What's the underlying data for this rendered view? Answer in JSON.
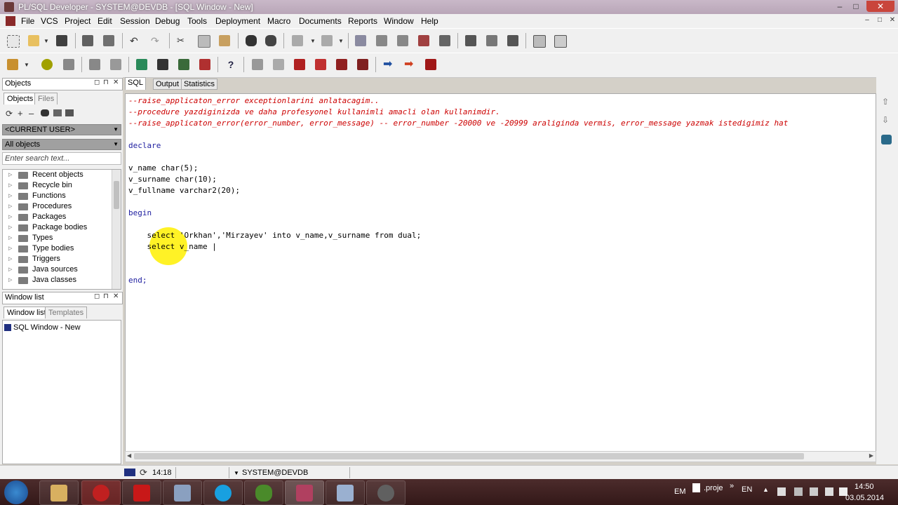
{
  "window": {
    "title": "PL/SQL Developer - SYSTEM@DEVDB - [SQL Window - New]",
    "controls": [
      "–",
      "□",
      "✕"
    ]
  },
  "menu": {
    "items": [
      "File",
      "VCS",
      "Project",
      "Edit",
      "Session",
      "Debug",
      "Tools",
      "Deployment",
      "Macro",
      "Documents",
      "Reports",
      "Window",
      "Help"
    ],
    "mdi_controls": [
      "–",
      "□",
      "✕"
    ]
  },
  "objects_pane": {
    "header": "Objects",
    "tabs": [
      "Objects",
      "Files"
    ],
    "user_combo": "<CURRENT USER>",
    "filter_combo": "All objects",
    "search_placeholder": "Enter search text...",
    "tree": [
      "Recent objects",
      "Recycle bin",
      "Functions",
      "Procedures",
      "Packages",
      "Package bodies",
      "Types",
      "Type bodies",
      "Triggers",
      "Java sources",
      "Java classes"
    ]
  },
  "window_list_pane": {
    "header": "Window list",
    "tabs": [
      "Window list",
      "Templates"
    ],
    "items": [
      "SQL Window - New"
    ]
  },
  "editor": {
    "tabs": [
      "SQL",
      "Output",
      "Statistics"
    ],
    "lines": [
      {
        "type": "comment",
        "text": "--raise_applicaton_error exceptionlarini anlatacagim.."
      },
      {
        "type": "comment",
        "text": "--procedure yazdiginizda ve daha profesyonel kullanimli amacli olan kullanimdir."
      },
      {
        "type": "comment",
        "text": "--raise_applicaton_error(error_number, error_message) -- error_number -20000 ve -20999 araliginda vermis, error_message yazmak istedigimiz hat"
      },
      {
        "type": "keyword",
        "text": "declare"
      },
      {
        "type": "code",
        "text": "v_name char(5);"
      },
      {
        "type": "code",
        "text": "v_surname char(10);"
      },
      {
        "type": "code",
        "text": "v_fullname varchar2(20);"
      },
      {
        "type": "keyword",
        "text": "begin"
      },
      {
        "type": "code",
        "text": "    select 'Orkhan','Mirzayev' into v_name,v_surname from dual;"
      },
      {
        "type": "code",
        "text": "    select v_name |"
      },
      {
        "type": "keyword",
        "text": "end;"
      }
    ]
  },
  "statusbar": {
    "position": "14:18",
    "connection": "SYSTEM@DEVDB"
  },
  "taskbar": {
    "tray_lang1": "EM",
    "tray_file": ".proje",
    "tray_lang2": "EN",
    "time": "14:50",
    "date": "03.05.2014",
    "chevron": "»"
  }
}
